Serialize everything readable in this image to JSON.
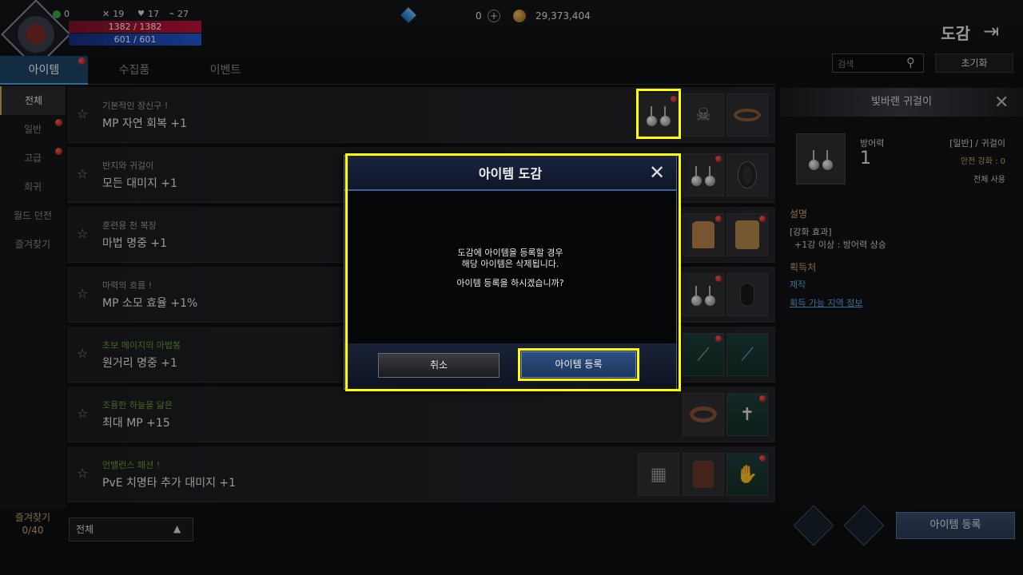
{
  "hud": {
    "stat_green": "0",
    "stat_attack": "19",
    "stat_defense": "17",
    "stat_speed": "27",
    "hp": "1382 / 1382",
    "mp": "601 / 601",
    "diamond": "0",
    "gold": "29,373,404"
  },
  "page_title": "도감",
  "tabs": [
    {
      "label": "아이템"
    },
    {
      "label": "수집품"
    },
    {
      "label": "이벤트"
    }
  ],
  "search_placeholder": "검색",
  "reset_label": "초기화",
  "categories": [
    {
      "label": "전체"
    },
    {
      "label": "일반"
    },
    {
      "label": "고급"
    },
    {
      "label": "희귀"
    },
    {
      "label": "월드 던전"
    },
    {
      "label": "즐겨찾기"
    }
  ],
  "collections": [
    {
      "subtitle": "기본적인 장신구 !",
      "effect": "MP 자연 회복 +1"
    },
    {
      "subtitle": "반지와 귀걸이",
      "effect": "모든 대미지 +1"
    },
    {
      "subtitle": "훈련용 천 복장",
      "effect": "마법 명중 +1"
    },
    {
      "subtitle": "마력의 흐름 !",
      "effect": "MP 소모 효율 +1%"
    },
    {
      "subtitle": "초보 메이지의 마법봉",
      "effect": "원거리 명중 +1"
    },
    {
      "subtitle": "조용한 하늘을 닮은",
      "effect": "최대 MP +15"
    },
    {
      "subtitle": "언밸런스 패션 !",
      "effect": "PvE 치명타 추가 대미지 +1"
    }
  ],
  "detail": {
    "title": "빛바랜 귀걸이",
    "stat_name": "방어력",
    "stat_value": "1",
    "grade": "[일반] / 귀걸이",
    "safe_enhance": "안전 강화 : 0",
    "usage": "전체 사용",
    "desc_label": "설명",
    "enhance_label": "[강화 효과]",
    "enhance_text": "+1강 이상 : 방어력 상승",
    "source_label": "획득처",
    "source_craft": "제작",
    "source_link": "획득 가능 지역 정보"
  },
  "favorites_label": "즐겨찾기",
  "favorites_count": "0/40",
  "filter_value": "전체",
  "register_button": "아이템 등록",
  "modal": {
    "title": "아이템 도감",
    "line1": "도감에 아이템을 등록할 경우",
    "line2": "해당 아이템은 삭제됩니다.",
    "line3": "아이템 등록을 하시겠습니까?",
    "cancel": "취소",
    "confirm": "아이템 등록"
  },
  "colors": {
    "accent": "#4aa3e0",
    "gold": "#c9a860",
    "highlight": "#ffff00",
    "notification": "#d01a1a"
  }
}
